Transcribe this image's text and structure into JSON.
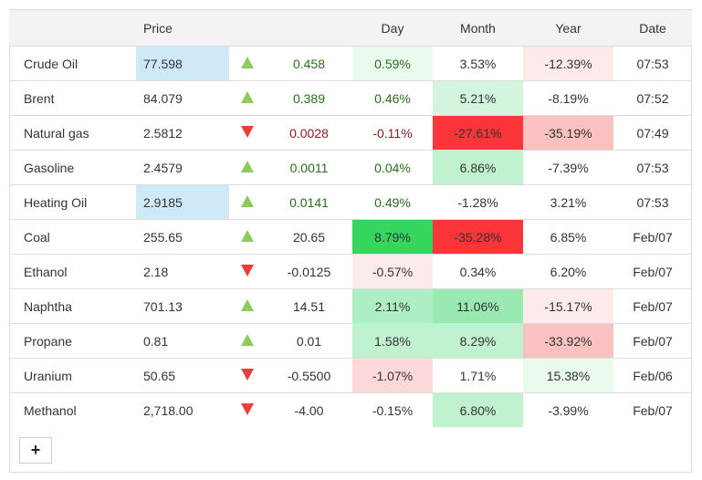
{
  "columns": {
    "name": "",
    "price": "Price",
    "arrow": "",
    "change": "",
    "day": "Day",
    "month": "Month",
    "year": "Year",
    "date": "Date"
  },
  "add_button": {
    "label": "+",
    "icon": "plus-icon"
  },
  "colors": {
    "up_arrow": "#8ccc5a",
    "down_arrow": "#ee3b3b",
    "price_highlight": "#cfe9f7",
    "positive_text": "#2a6e1c",
    "negative_text": "#8b1a1a"
  },
  "rows": [
    {
      "name": "Crude Oil",
      "price": "77.598",
      "price_bg": "#cfe9f7",
      "dir": "up",
      "change": "0.458",
      "change_color": "#2a6e1c",
      "day": "0.59%",
      "day_bg": "#ebfaee",
      "day_color": "#2a6e1c",
      "month": "3.53%",
      "month_bg": "",
      "year": "-12.39%",
      "year_bg": "#fdeaea",
      "date": "07:53"
    },
    {
      "name": "Brent",
      "price": "84.079",
      "price_bg": "",
      "dir": "up",
      "change": "0.389",
      "change_color": "#2a6e1c",
      "day": "0.46%",
      "day_bg": "",
      "day_color": "#2a6e1c",
      "month": "5.21%",
      "month_bg": "#d3f5de",
      "year": "-8.19%",
      "year_bg": "",
      "date": "07:52"
    },
    {
      "name": "Natural gas",
      "price": "2.5812",
      "price_bg": "",
      "dir": "down",
      "change": "0.0028",
      "change_color": "#8b1a1a",
      "day": "-0.11%",
      "day_bg": "",
      "day_color": "#8b1a1a",
      "month": "-27.61%",
      "month_bg": "#fb3538",
      "year": "-35.19%",
      "year_bg": "#fbc0c0",
      "date": "07:49"
    },
    {
      "name": "Gasoline",
      "price": "2.4579",
      "price_bg": "",
      "dir": "up",
      "change": "0.0011",
      "change_color": "#2a6e1c",
      "day": "0.04%",
      "day_bg": "",
      "day_color": "#2a6e1c",
      "month": "6.86%",
      "month_bg": "#c0f2d0",
      "year": "-7.39%",
      "year_bg": "",
      "date": "07:53"
    },
    {
      "name": "Heating Oil",
      "price": "2.9185",
      "price_bg": "#cfe9f7",
      "dir": "up",
      "change": "0.0141",
      "change_color": "#2a6e1c",
      "day": "0.49%",
      "day_bg": "",
      "day_color": "#2a6e1c",
      "month": "-1.28%",
      "month_bg": "",
      "year": "3.21%",
      "year_bg": "",
      "date": "07:53"
    },
    {
      "name": "Coal",
      "price": "255.65",
      "price_bg": "",
      "dir": "up",
      "change": "20.65",
      "change_color": "",
      "day": "8.79%",
      "day_bg": "#34d65d",
      "day_color": "",
      "month": "-35.28%",
      "month_bg": "#fb3538",
      "year": "6.85%",
      "year_bg": "",
      "date": "Feb/07"
    },
    {
      "name": "Ethanol",
      "price": "2.18",
      "price_bg": "",
      "dir": "down",
      "change": "-0.0125",
      "change_color": "",
      "day": "-0.57%",
      "day_bg": "#fdeaea",
      "day_color": "",
      "month": "0.34%",
      "month_bg": "",
      "year": "6.20%",
      "year_bg": "",
      "date": "Feb/07"
    },
    {
      "name": "Naphtha",
      "price": "701.13",
      "price_bg": "",
      "dir": "up",
      "change": "14.51",
      "change_color": "",
      "day": "2.11%",
      "day_bg": "#aeeec4",
      "day_color": "",
      "month": "11.06%",
      "month_bg": "#9ae9b3",
      "year": "-15.17%",
      "year_bg": "#fdeaea",
      "date": "Feb/07"
    },
    {
      "name": "Propane",
      "price": "0.81",
      "price_bg": "",
      "dir": "up",
      "change": "0.01",
      "change_color": "",
      "day": "1.58%",
      "day_bg": "#c0f2d0",
      "day_color": "",
      "month": "8.29%",
      "month_bg": "#c0f2d0",
      "year": "-33.92%",
      "year_bg": "#fbc0c0",
      "date": "Feb/07"
    },
    {
      "name": "Uranium",
      "price": "50.65",
      "price_bg": "",
      "dir": "down",
      "change": "-0.5500",
      "change_color": "",
      "day": "-1.07%",
      "day_bg": "#fdd8d8",
      "day_color": "",
      "month": "1.71%",
      "month_bg": "",
      "year": "15.38%",
      "year_bg": "#ebfaee",
      "date": "Feb/06"
    },
    {
      "name": "Methanol",
      "price": "2,718.00",
      "price_bg": "",
      "dir": "down",
      "change": "-4.00",
      "change_color": "",
      "day": "-0.15%",
      "day_bg": "",
      "day_color": "",
      "month": "6.80%",
      "month_bg": "#c0f2d0",
      "year": "-3.99%",
      "year_bg": "",
      "date": "Feb/07"
    }
  ]
}
